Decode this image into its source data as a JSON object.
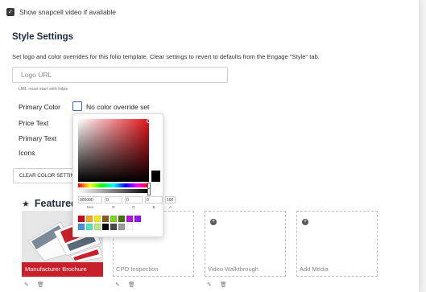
{
  "snapcell": {
    "label": "Show snapcell video if available",
    "checked": true
  },
  "style_settings": {
    "title": "Style Settings",
    "description": "Set logo and color overrides for this folio template. Clear settings to revert to defaults from the Engage \"Style\" tab.",
    "logo_url": {
      "placeholder": "Logo URL",
      "value": "",
      "hint": "URL must start with https"
    },
    "primary_color_label": "Primary Color",
    "primary_color_status": "No color override set",
    "price_text_label": "Price Text",
    "primary_text_label": "Primary Text",
    "icons_label": "Icons",
    "clear_button": "CLEAR COLOR SETTINGS"
  },
  "color_picker": {
    "hex_label": "Hex",
    "r_label": "R",
    "g_label": "G",
    "b_label": "B",
    "a_label": "A",
    "hex": "000000",
    "r": "0",
    "g": "0",
    "b": "0",
    "a": "100",
    "hue": 1.0,
    "alpha": 1.0,
    "swatches": [
      "#d0021b",
      "#f5a623",
      "#f8e71c",
      "#8b572a",
      "#7ed321",
      "#417505",
      "#bd10e0",
      "#9013fe",
      "#4a90e2",
      "#50e3c2",
      "#b8e986",
      "#000000",
      "#4a4a4a",
      "#9b9b9b",
      "#ffffff"
    ]
  },
  "featured": {
    "title": "Featured",
    "slots": [
      {
        "label": "Manufacturer Brochure",
        "filled": true
      },
      {
        "label": "CPO Inspection",
        "filled": false
      },
      {
        "label": "Video Walkthrough",
        "filled": false
      },
      {
        "label": "Add Media",
        "filled": false
      }
    ]
  },
  "icons": {
    "check": "✓",
    "star": "★",
    "plus": "+",
    "pencil": "✎",
    "trash": "🗑"
  },
  "colors": {
    "accent": "#c8202b",
    "focus_border": "#2f6fb6"
  }
}
